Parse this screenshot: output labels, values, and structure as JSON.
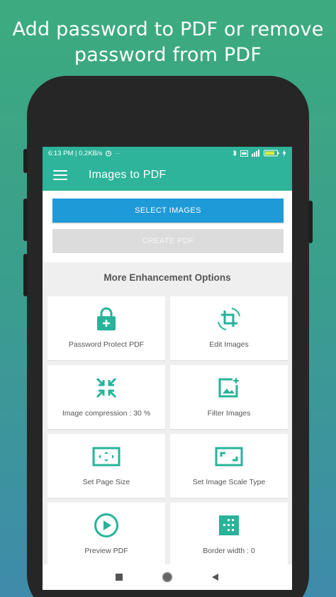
{
  "headline": {
    "line1": "Add password to PDF or remove",
    "line2": "password from PDF"
  },
  "status_bar": {
    "time_speed": "6:13 PM | 0.2KB/s",
    "dots": "··",
    "right_icons": [
      "bluetooth-icon",
      "volte-icon",
      "signal-icon",
      "battery-icon",
      "charging-icon"
    ]
  },
  "app_bar": {
    "title": "Images to PDF",
    "menu_icon": "hamburger-menu-icon"
  },
  "buttons": {
    "select_images": "SELECT IMAGES",
    "create_pdf": "CREATE PDF"
  },
  "enhancement": {
    "title": "More Enhancement Options",
    "options": [
      {
        "label": "Password Protect PDF",
        "icon": "lock-plus-icon"
      },
      {
        "label": "Edit Images",
        "icon": "crop-rotate-icon"
      },
      {
        "label": "Image compression : 30 %",
        "icon": "compress-arrows-icon"
      },
      {
        "label": "Filter Images",
        "icon": "image-filter-icon"
      },
      {
        "label": "Set Page Size",
        "icon": "page-size-icon"
      },
      {
        "label": "Set Image Scale Type",
        "icon": "scale-type-icon"
      },
      {
        "label": "Preview PDF",
        "icon": "play-circle-icon"
      },
      {
        "label": "Border width : 0",
        "icon": "border-icon"
      }
    ]
  },
  "colors": {
    "primary": "#2db49a",
    "accent_button": "#1e9ad8",
    "icon": "#28b39a",
    "disabled_button": "#dcdcdc"
  },
  "nav_bar": {
    "icons": [
      "recents-square-icon",
      "home-circle-icon",
      "back-triangle-icon"
    ]
  }
}
